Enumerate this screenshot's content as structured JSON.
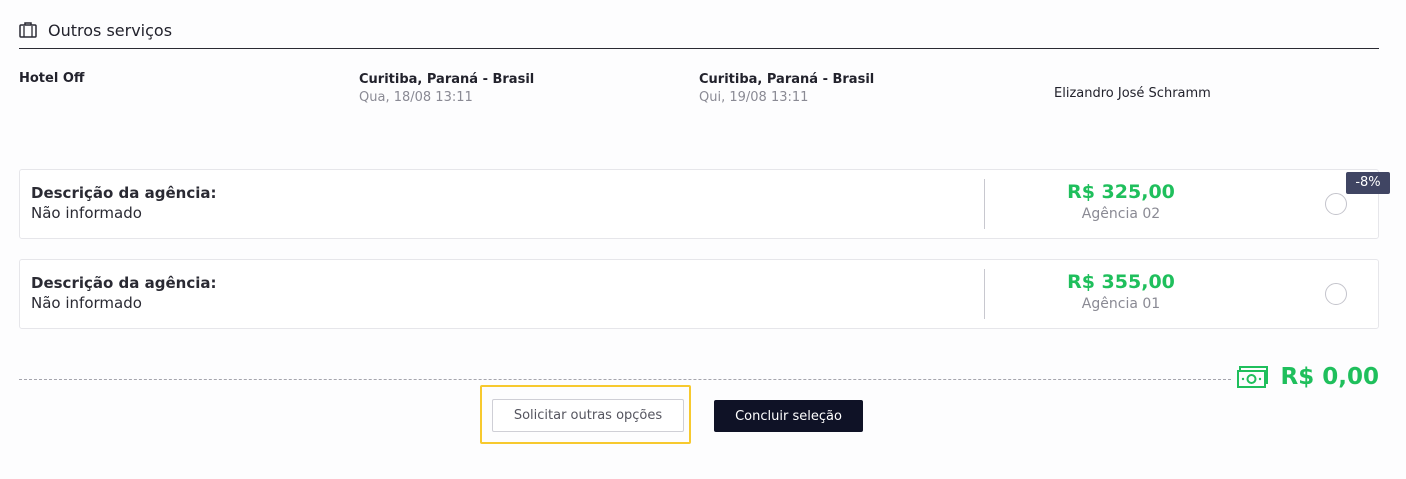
{
  "section": {
    "title": "Outros serviços",
    "icon": "luggage-icon"
  },
  "trip": {
    "service_name": "Hotel Off",
    "origin": {
      "city": "Curitiba, Paraná - Brasil",
      "date": "Qua, 18/08 13:11"
    },
    "destination": {
      "city": "Curitiba, Paraná - Brasil",
      "date": "Qui, 19/08 13:11"
    },
    "traveler": "Elizandro José Schramm"
  },
  "options": [
    {
      "desc_label": "Descrição da agência:",
      "desc_value": "Não informado",
      "price": "R$ 325,00",
      "agency": "Agência 02",
      "badge": "-8%",
      "selected": false
    },
    {
      "desc_label": "Descrição da agência:",
      "desc_value": "Não informado",
      "price": "R$ 355,00",
      "agency": "Agência 01",
      "selected": false
    }
  ],
  "summary": {
    "total": "R$ 0,00",
    "icon": "money-icon"
  },
  "actions": {
    "request_more_label": "Solicitar outras opções",
    "confirm_label": "Concluir seleção"
  },
  "colors": {
    "price_green": "#1fbf5c",
    "primary_button": "#0f1226",
    "badge": "#404563",
    "highlight": "#f7c92e"
  }
}
